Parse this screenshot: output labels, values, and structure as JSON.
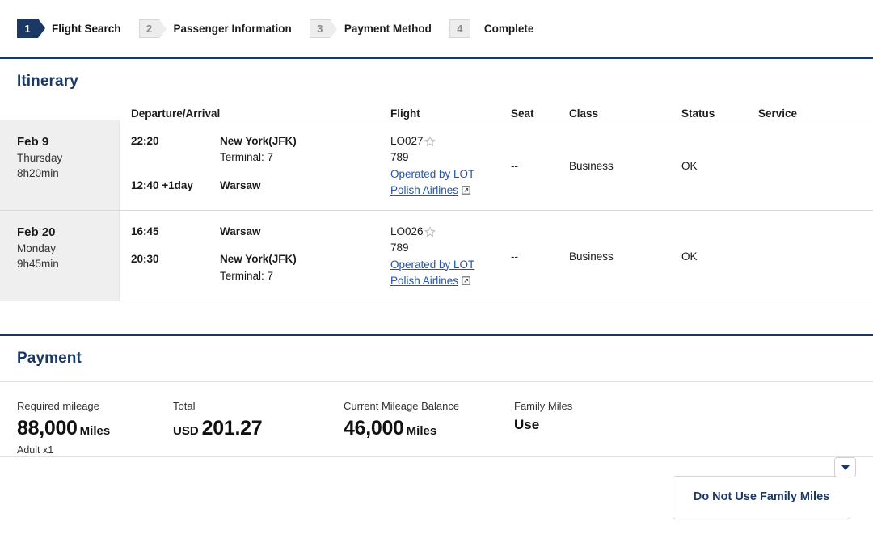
{
  "theme": {
    "navy": "#1b3864",
    "link": "#2155a8",
    "row_alt_bg": "#efefef",
    "badge_inactive_bg": "#ededed"
  },
  "steps": [
    {
      "number": "1",
      "label": "Flight Search",
      "state": "active",
      "shape": "arrow"
    },
    {
      "number": "2",
      "label": "Passenger Information",
      "state": "inactive",
      "shape": "arrow"
    },
    {
      "number": "3",
      "label": "Payment Method",
      "state": "inactive",
      "shape": "arrow"
    },
    {
      "number": "4",
      "label": "Complete",
      "state": "inactive",
      "shape": "square"
    }
  ],
  "itinerary": {
    "title": "Itinerary",
    "columns": {
      "date": "",
      "departure_arrival": "Departure/Arrival",
      "flight": "Flight",
      "seat": "Seat",
      "class": "Class",
      "status": "Status",
      "service": "Service"
    },
    "rows": [
      {
        "date": "Feb 9",
        "weekday": "Thursday",
        "duration": "8h20min",
        "depart_time": "22:20",
        "depart_port": "New York(JFK)",
        "depart_terminal": "Terminal: 7",
        "arrive_time": "12:40 +1day",
        "arrive_port": "Warsaw",
        "arrive_terminal": "",
        "flight_number": "LO027",
        "flight_star_icon": "star-outline-icon",
        "equipment": "789",
        "operated_by": "Operated by LOT Polish Airlines",
        "operated_by_icon": "external-link-icon",
        "seat": "--",
        "class": "Business",
        "status": "OK",
        "service": ""
      },
      {
        "date": "Feb 20",
        "weekday": "Monday",
        "duration": "9h45min",
        "depart_time": "16:45",
        "depart_port": "Warsaw",
        "depart_terminal": "",
        "arrive_time": "20:30",
        "arrive_port": "New York(JFK)",
        "arrive_terminal": "Terminal: 7",
        "flight_number": "LO026",
        "flight_star_icon": "star-outline-icon",
        "equipment": "789",
        "operated_by": "Operated by LOT Polish Airlines",
        "operated_by_icon": "external-link-icon",
        "seat": "--",
        "class": "Business",
        "status": "OK",
        "service": ""
      }
    ]
  },
  "payment": {
    "title": "Payment",
    "required_mileage": {
      "label": "Required mileage",
      "amount": "88,000",
      "unit": "Miles",
      "note": "Adult x1"
    },
    "total": {
      "label": "Total",
      "currency": "USD",
      "amount": "201.27"
    },
    "balance": {
      "label": "Current Mileage Balance",
      "amount": "46,000",
      "unit": "Miles"
    },
    "family_miles": {
      "label": "Family Miles",
      "value": "Use",
      "dropdown_icon": "caret-down-icon"
    },
    "do_not_use_button": "Do Not Use Family Miles"
  }
}
